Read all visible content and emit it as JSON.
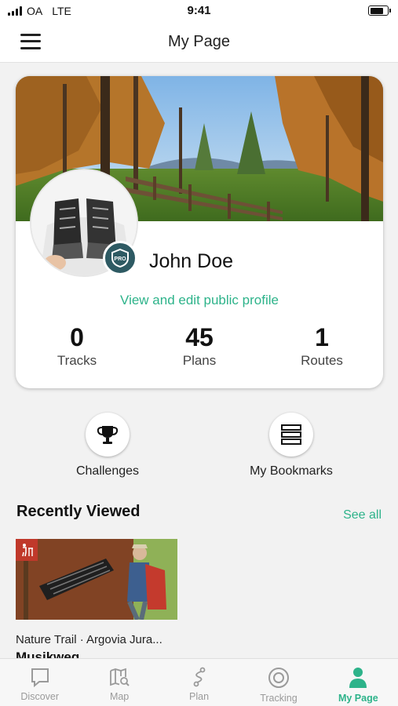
{
  "status_bar": {
    "carrier": "OA",
    "network": "LTE",
    "time": "9:41"
  },
  "header": {
    "title": "My Page",
    "menu_icon": "hamburger-menu-icon"
  },
  "profile": {
    "name": "John Doe",
    "badge": "PRO",
    "link_label": "View and edit public profile",
    "stats": [
      {
        "value": "0",
        "label": "Tracks"
      },
      {
        "value": "45",
        "label": "Plans"
      },
      {
        "value": "1",
        "label": "Routes"
      }
    ]
  },
  "quick_actions": [
    {
      "label": "Challenges",
      "icon": "trophy-icon"
    },
    {
      "label": "My Bookmarks",
      "icon": "bookmarks-icon"
    }
  ],
  "recently_viewed": {
    "title": "Recently Viewed",
    "see_all_label": "See all",
    "items": [
      {
        "subtitle": "Nature Trail · Argovia Jura...",
        "title": "Musikweg",
        "type_icon": "hiking-trail-icon"
      }
    ]
  },
  "tabs": [
    {
      "label": "Discover",
      "icon": "discover-icon",
      "active": false
    },
    {
      "label": "Map",
      "icon": "map-icon",
      "active": false
    },
    {
      "label": "Plan",
      "icon": "plan-icon",
      "active": false
    },
    {
      "label": "Tracking",
      "icon": "tracking-icon",
      "active": false
    },
    {
      "label": "My Page",
      "icon": "person-icon",
      "active": true
    }
  ],
  "colors": {
    "accent": "#2db38a",
    "badge": "#2e5a63",
    "inactive": "#9a9a9a"
  }
}
